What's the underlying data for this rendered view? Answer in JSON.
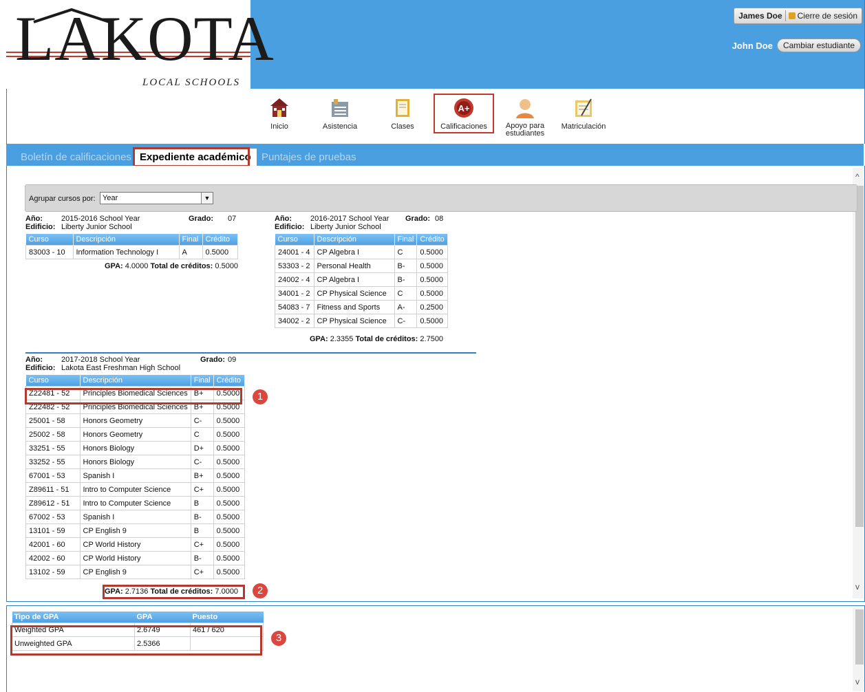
{
  "header": {
    "logo_text": "LAKOTA",
    "logo_sub": "LOCAL SCHOOLS",
    "user_name": "James Doe",
    "logout_label": "Cierre de sesión",
    "student_name": "John Doe",
    "change_student_label": "Cambiar estudiante"
  },
  "nav": {
    "items": [
      {
        "label": "Inicio",
        "icon": "school-house-icon"
      },
      {
        "label": "Asistencia",
        "icon": "attendance-icon"
      },
      {
        "label": "Clases",
        "icon": "classes-icon"
      },
      {
        "label": "Calificaciones",
        "icon": "grades-icon"
      },
      {
        "label": "Apoyo para estudiantes",
        "icon": "student-support-icon"
      },
      {
        "label": "Matriculación",
        "icon": "enrollment-icon"
      }
    ],
    "active": "Calificaciones"
  },
  "tabs": [
    {
      "label": "Boletín de calificaciones",
      "active": false
    },
    {
      "label": "Expediente académico",
      "active": true
    },
    {
      "label": "Puntajes de pruebas",
      "active": false
    }
  ],
  "group": {
    "label": "Agrupar cursos por:",
    "value": "Year"
  },
  "labels": {
    "year": "Año:",
    "grade": "Grado:",
    "building": "Edificio:",
    "gpa": "GPA:",
    "total_credits": "Total de créditos:",
    "col_course": "Curso",
    "col_description": "Descripción",
    "col_final": "Final",
    "col_credit": "Crédito"
  },
  "blocks": [
    {
      "year": "2015-2016 School Year",
      "grade": "07",
      "building": "Liberty Junior School",
      "rows": [
        [
          "83003 - 10",
          "Information Technology I",
          "A",
          "0.5000"
        ]
      ],
      "gpa": "4.0000",
      "total_credits": "0.5000"
    },
    {
      "year": "2016-2017 School Year",
      "grade": "08",
      "building": "Liberty Junior School",
      "rows": [
        [
          "24001 - 4",
          "CP Algebra I",
          "C",
          "0.5000"
        ],
        [
          "53303 - 2",
          "Personal Health",
          "B-",
          "0.5000"
        ],
        [
          "24002 - 4",
          "CP Algebra I",
          "B-",
          "0.5000"
        ],
        [
          "34001 - 2",
          "CP Physical Science",
          "C",
          "0.5000"
        ],
        [
          "54083 - 7",
          "Fitness and Sports",
          "A-",
          "0.2500"
        ],
        [
          "34002 - 2",
          "CP Physical Science",
          "C-",
          "0.5000"
        ]
      ],
      "gpa": "2.3355",
      "total_credits": "2.7500"
    },
    {
      "year": "2017-2018 School Year",
      "grade": "09",
      "building": "Lakota East Freshman High School",
      "rows": [
        [
          "Z22481 - 52",
          "Principles Biomedical Sciences",
          "B+",
          "0.5000"
        ],
        [
          "Z22482 - 52",
          "Principles Biomedical Sciences",
          "B+",
          "0.5000"
        ],
        [
          "25001 - 58",
          "Honors Geometry",
          "C-",
          "0.5000"
        ],
        [
          "25002 - 58",
          "Honors Geometry",
          "C",
          "0.5000"
        ],
        [
          "33251 - 55",
          "Honors Biology",
          "D+",
          "0.5000"
        ],
        [
          "33252 - 55",
          "Honors Biology",
          "C-",
          "0.5000"
        ],
        [
          "67001 - 53",
          "Spanish I",
          "B+",
          "0.5000"
        ],
        [
          "Z89611 - 51",
          "Intro to Computer Science",
          "C+",
          "0.5000"
        ],
        [
          "Z89612 - 51",
          "Intro to Computer Science",
          "B",
          "0.5000"
        ],
        [
          "67002 - 53",
          "Spanish I",
          "B-",
          "0.5000"
        ],
        [
          "13101 - 59",
          "CP English 9",
          "B",
          "0.5000"
        ],
        [
          "42001 - 60",
          "CP World History",
          "C+",
          "0.5000"
        ],
        [
          "42002 - 60",
          "CP World History",
          "B-",
          "0.5000"
        ],
        [
          "13102 - 59",
          "CP English 9",
          "C+",
          "0.5000"
        ]
      ],
      "gpa": "2.7136",
      "total_credits": "7.0000"
    }
  ],
  "gpa_summary": {
    "headers": [
      "Tipo de GPA",
      "GPA",
      "Puesto"
    ],
    "rows": [
      [
        "Weighted GPA",
        "2.6749",
        "461 / 620"
      ],
      [
        "Unweighted GPA",
        "2.5366",
        ""
      ]
    ]
  },
  "callouts": [
    "1",
    "2",
    "3"
  ],
  "colors": {
    "header_blue": "#4a9fe0",
    "highlight_red": "#b03a2e",
    "badge_red": "#d9473f"
  }
}
